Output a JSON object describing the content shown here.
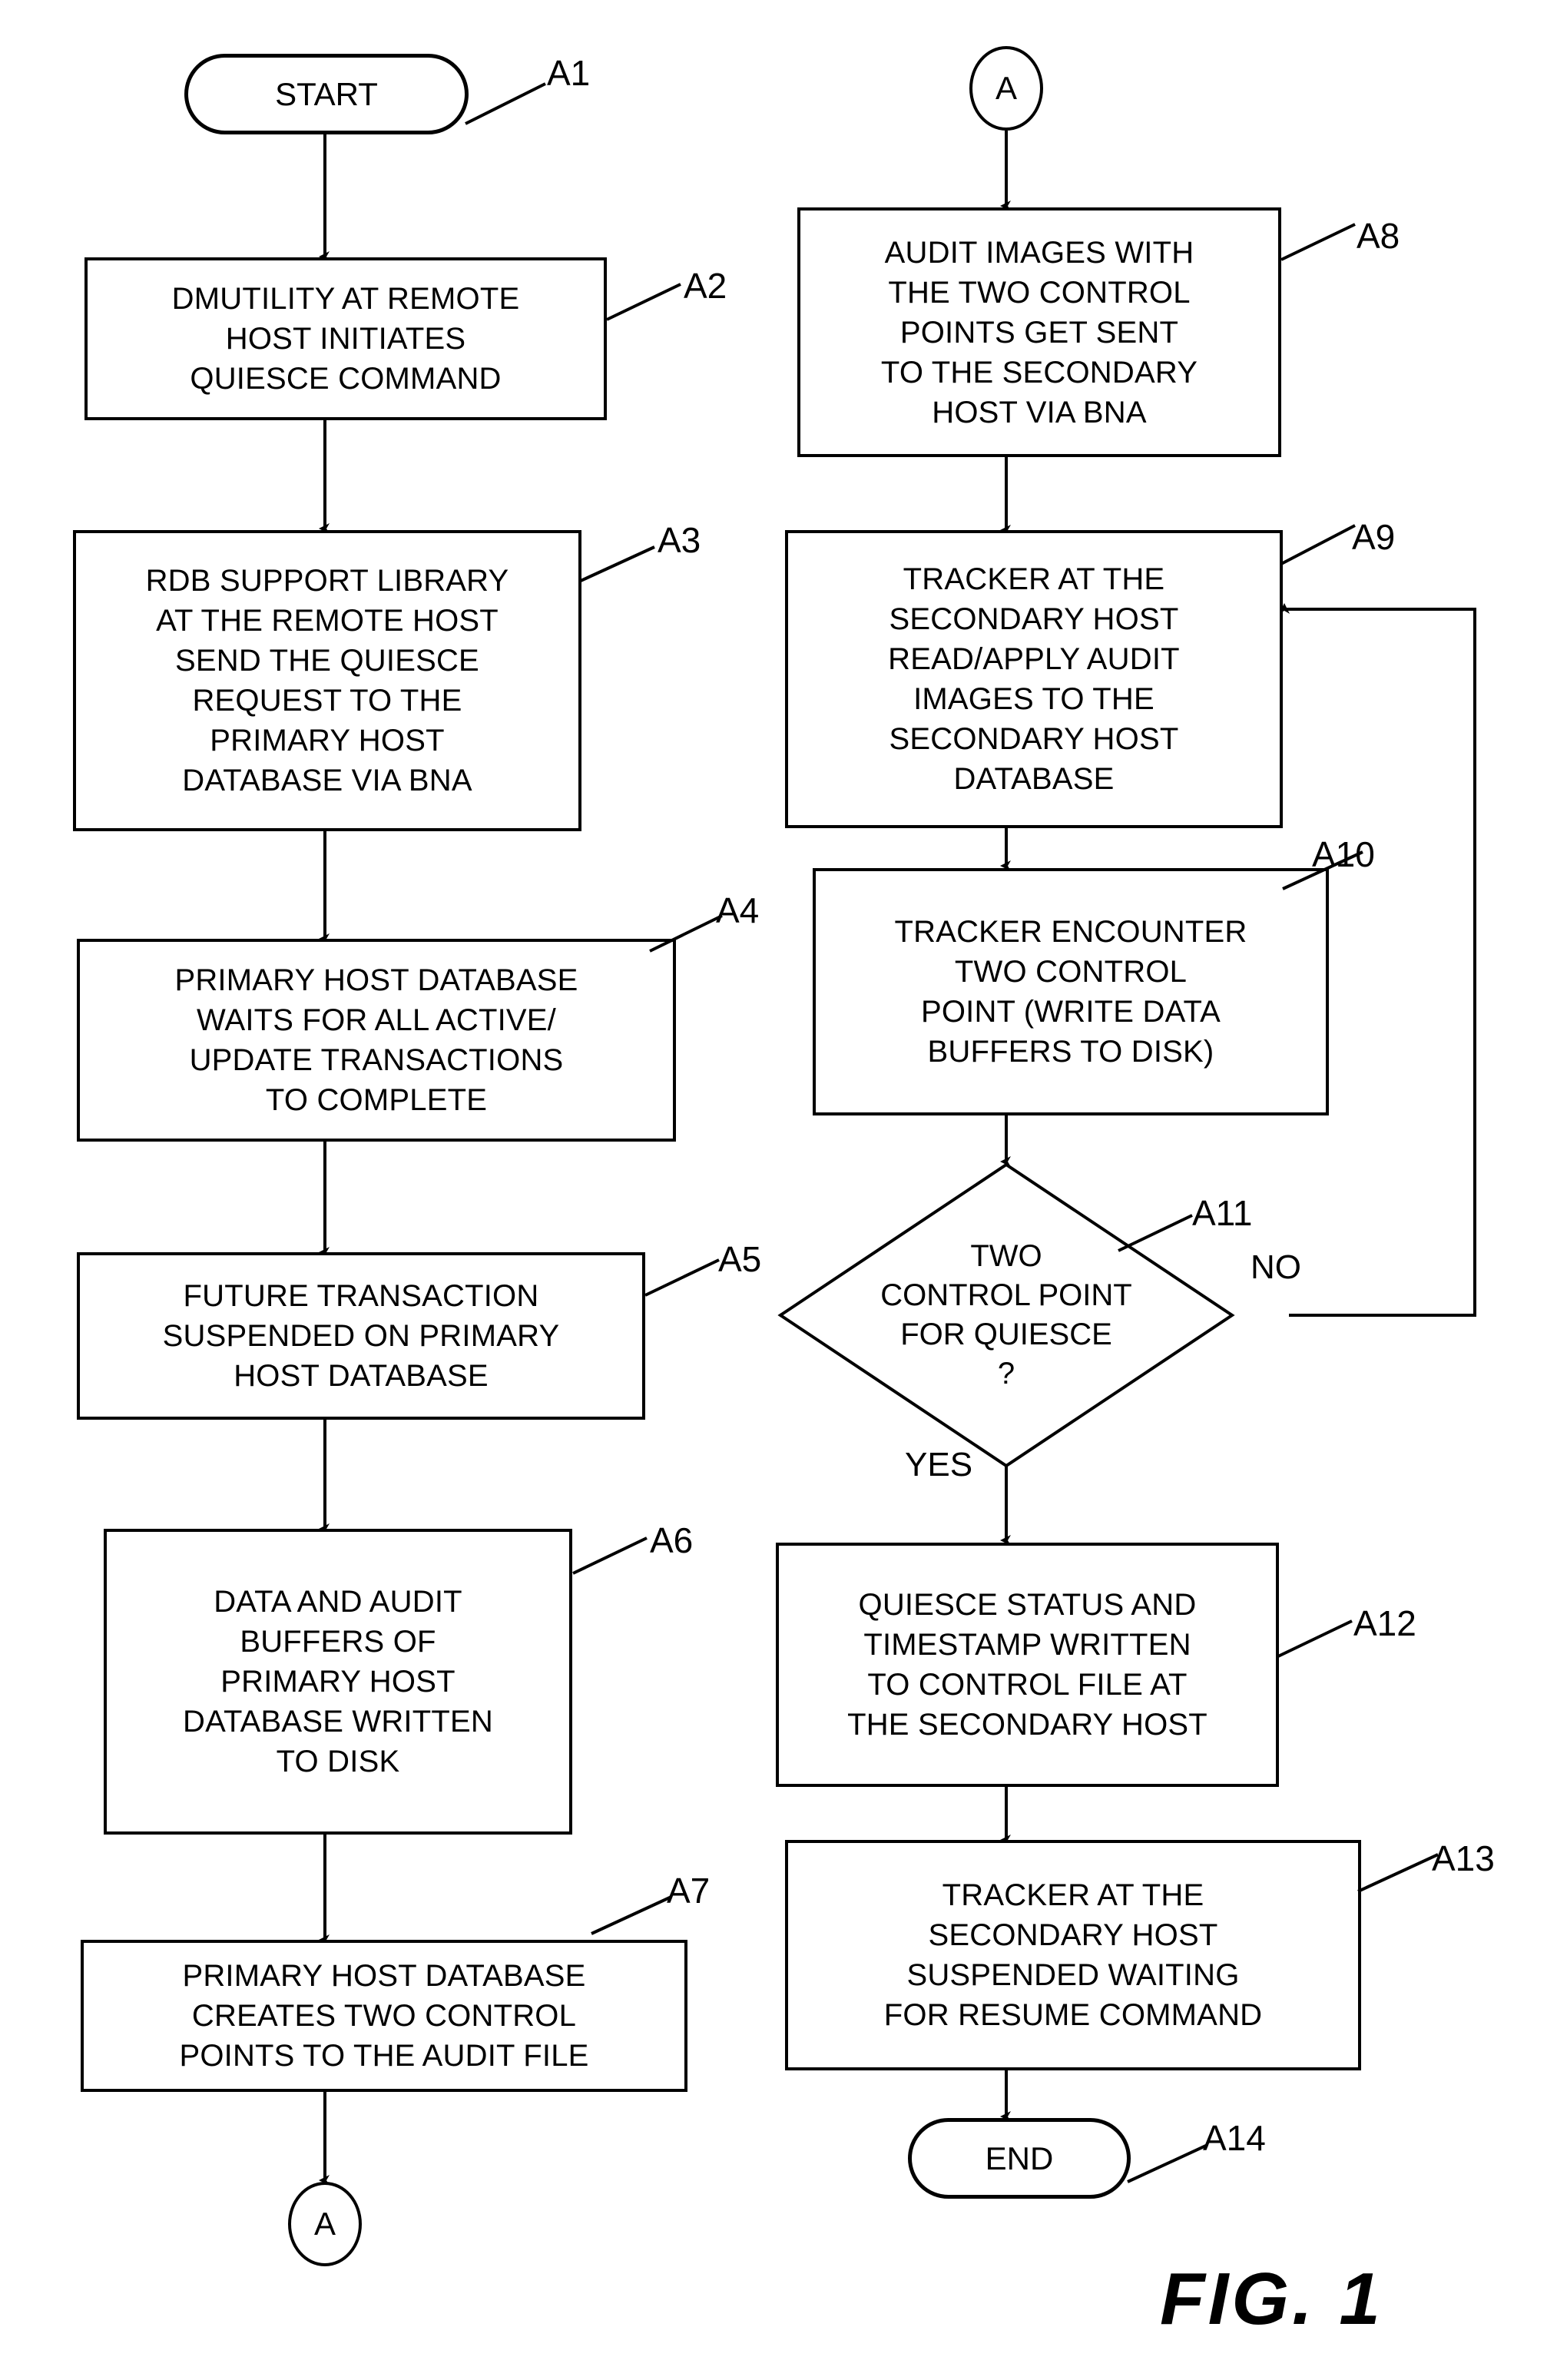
{
  "figure": {
    "label": "FIG. 1"
  },
  "nodes": {
    "start": {
      "text": "START",
      "ref": "A1"
    },
    "a2": {
      "text": "DMUTILITY AT REMOTE\nHOST INITIATES\nQUIESCE COMMAND",
      "ref": "A2"
    },
    "a3": {
      "text": "RDB SUPPORT LIBRARY\nAT THE REMOTE HOST\nSEND THE QUIESCE\nREQUEST TO THE\nPRIMARY HOST\nDATABASE VIA BNA",
      "ref": "A3"
    },
    "a4": {
      "text": "PRIMARY HOST DATABASE\nWAITS FOR ALL ACTIVE/\nUPDATE TRANSACTIONS\nTO COMPLETE",
      "ref": "A4"
    },
    "a5": {
      "text": "FUTURE TRANSACTION\nSUSPENDED ON PRIMARY\nHOST DATABASE",
      "ref": "A5"
    },
    "a6": {
      "text": "DATA AND AUDIT\nBUFFERS OF\nPRIMARY HOST\nDATABASE WRITTEN\nTO DISK",
      "ref": "A6"
    },
    "a7": {
      "text": "PRIMARY HOST DATABASE\nCREATES TWO CONTROL\nPOINTS TO THE AUDIT FILE",
      "ref": "A7"
    },
    "conn_out": {
      "text": "A"
    },
    "conn_in": {
      "text": "A"
    },
    "a8": {
      "text": "AUDIT IMAGES WITH\nTHE TWO CONTROL\nPOINTS GET SENT\nTO THE SECONDARY\nHOST VIA BNA",
      "ref": "A8"
    },
    "a9": {
      "text": "TRACKER AT THE\nSECONDARY HOST\nREAD/APPLY AUDIT\nIMAGES TO THE\nSECONDARY HOST\nDATABASE",
      "ref": "A9"
    },
    "a10": {
      "text": "TRACKER ENCOUNTER\nTWO CONTROL\nPOINT (WRITE DATA\nBUFFERS TO DISK)",
      "ref": "A10"
    },
    "a11": {
      "line1": "TWO",
      "line2": "CONTROL POINT",
      "line3": "FOR QUIESCE",
      "line4": "?",
      "ref": "A11"
    },
    "a12": {
      "text": "QUIESCE STATUS AND\nTIMESTAMP WRITTEN\nTO CONTROL FILE AT\nTHE SECONDARY HOST",
      "ref": "A12"
    },
    "a13": {
      "text": "TRACKER AT THE\nSECONDARY HOST\nSUSPENDED WAITING\nFOR RESUME COMMAND",
      "ref": "A13"
    },
    "end": {
      "text": "END",
      "ref": "A14"
    }
  },
  "edge_labels": {
    "yes": "YES",
    "no": "NO"
  },
  "colors": {
    "ink": "#000000",
    "paper": "#ffffff"
  }
}
